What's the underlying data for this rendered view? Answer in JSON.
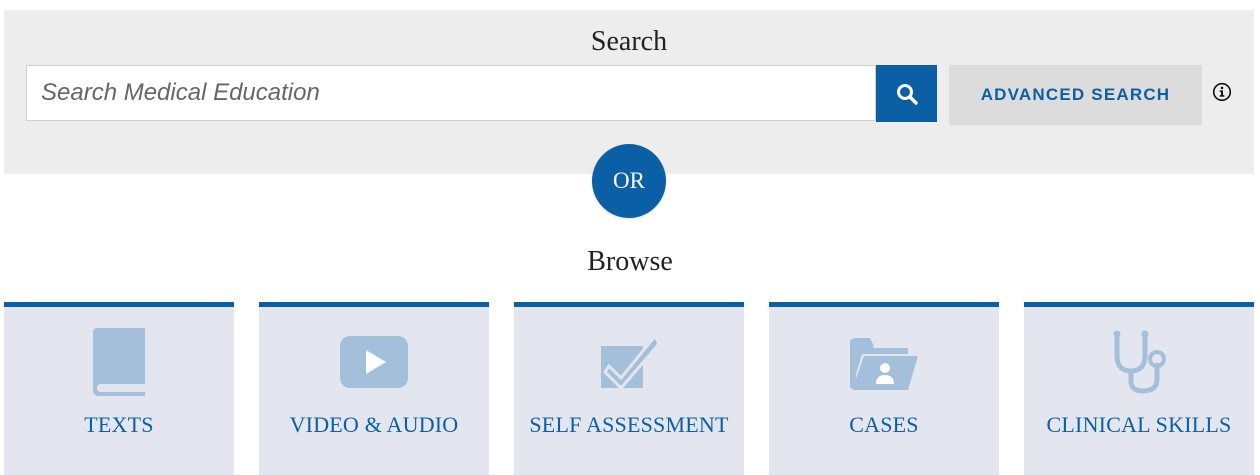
{
  "search": {
    "heading": "Search",
    "placeholder": "Search Medical Education",
    "value": "",
    "submit_icon": "search-icon",
    "advanced_label": "ADVANCED SEARCH",
    "info_icon": "info-icon"
  },
  "divider": {
    "or_label": "OR"
  },
  "browse": {
    "heading": "Browse",
    "tiles": [
      {
        "label": "TEXTS",
        "icon": "book-icon"
      },
      {
        "label": "VIDEO & AUDIO",
        "icon": "video-play-icon"
      },
      {
        "label": "SELF ASSESSMENT",
        "icon": "checkbox-icon"
      },
      {
        "label": "CASES",
        "icon": "folder-user-icon"
      },
      {
        "label": "CLINICAL SKILLS",
        "icon": "stethoscope-icon"
      }
    ]
  },
  "colors": {
    "accent": "#0b5fa5",
    "panel": "#ededed",
    "tile_bg": "#e3e6ee",
    "icon_fill": "#a3bfd9"
  }
}
